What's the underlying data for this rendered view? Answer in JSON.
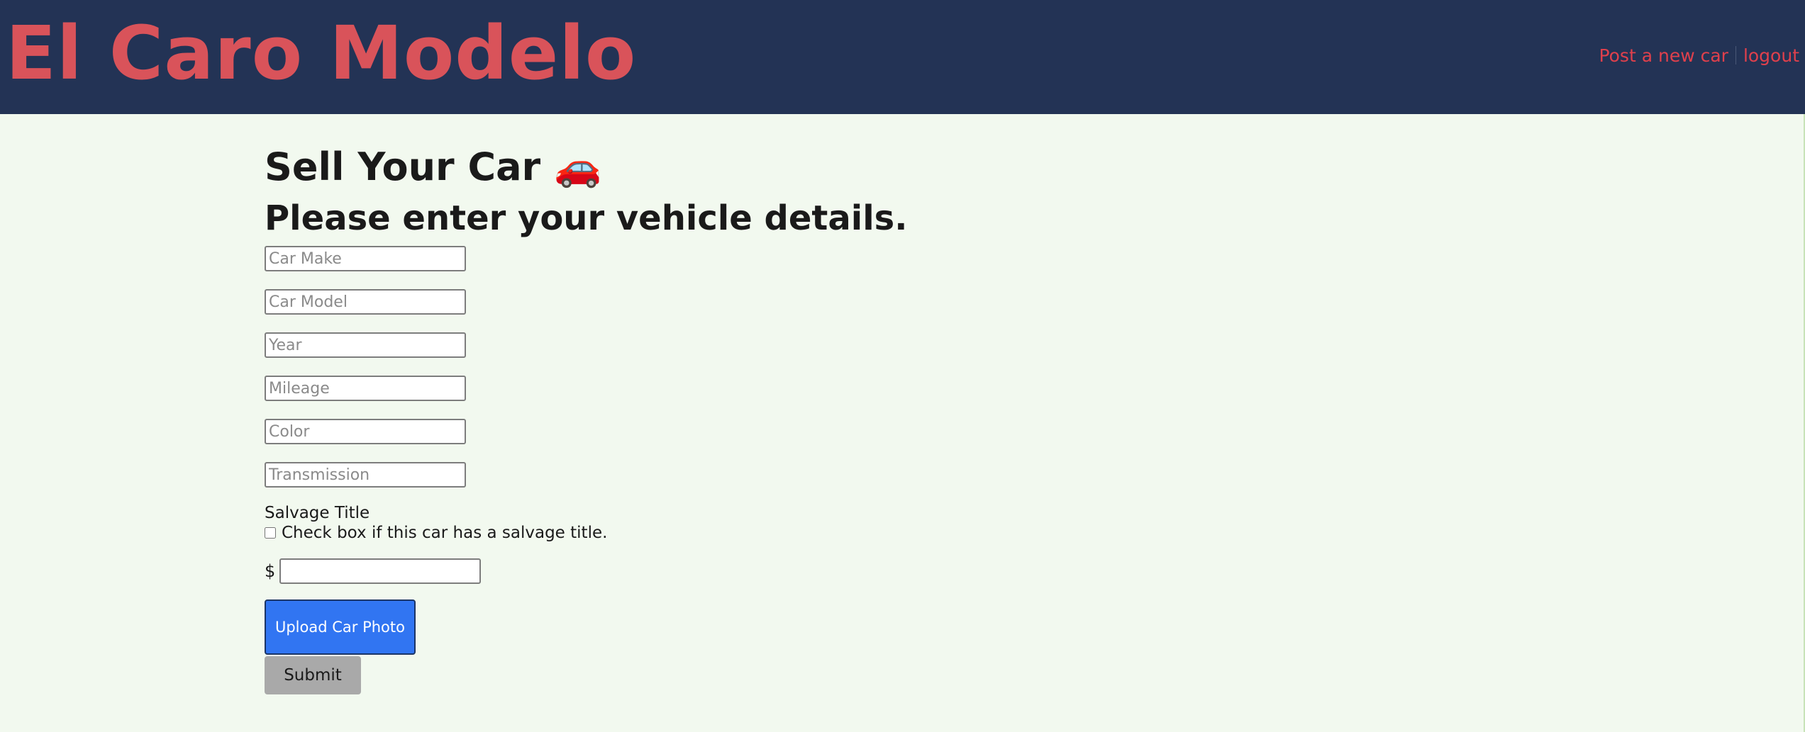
{
  "header": {
    "brand": "El Caro Modelo",
    "nav": [
      {
        "label": "Post a new car"
      },
      {
        "label": "logout"
      }
    ]
  },
  "form": {
    "title": "Sell Your Car 🚗",
    "subtitle": "Please enter your vehicle details.",
    "make": {
      "placeholder": "Car Make",
      "value": ""
    },
    "model": {
      "placeholder": "Car Model",
      "value": ""
    },
    "year": {
      "placeholder": "Year",
      "value": ""
    },
    "mileage": {
      "placeholder": "Mileage",
      "value": ""
    },
    "color": {
      "placeholder": "Color",
      "value": ""
    },
    "transmission": {
      "placeholder": "Transmission",
      "value": ""
    },
    "salvage": {
      "label": "Salvage Title",
      "checkbox_label": "Check box if this car has a salvage title.",
      "checked": false
    },
    "price": {
      "currency": "$",
      "value": ""
    },
    "upload_label": "Upload Car Photo",
    "submit_label": "Submit"
  },
  "colors": {
    "header_bg": "#233355",
    "brand": "#d9535a",
    "nav_link": "#e0404c",
    "page_bg": "#f2f9ef",
    "upload_button": "#3175f2",
    "submit_button": "#a9a9a9"
  }
}
